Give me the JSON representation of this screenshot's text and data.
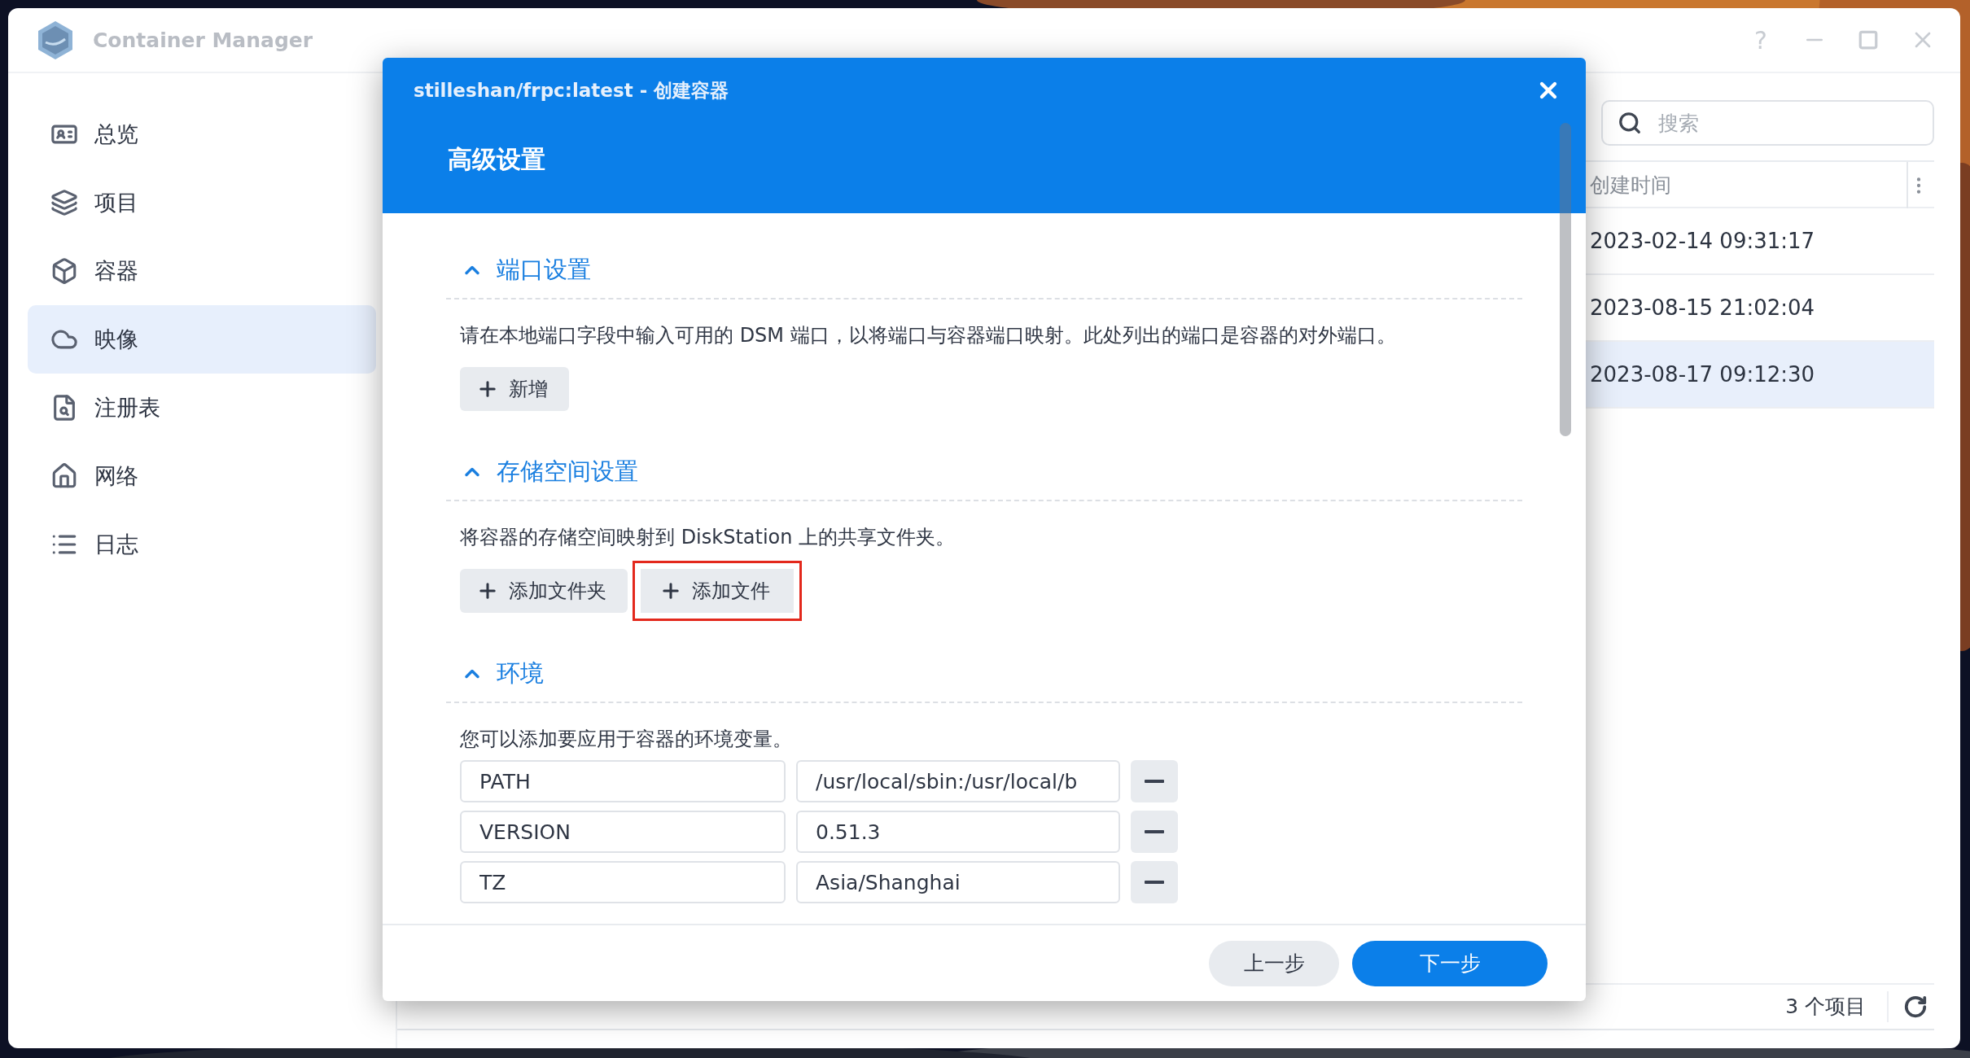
{
  "window": {
    "title": "Container Manager",
    "help": "?"
  },
  "sidebar": {
    "items": [
      {
        "label": "总览",
        "selected": false
      },
      {
        "label": "项目",
        "selected": false
      },
      {
        "label": "容器",
        "selected": false
      },
      {
        "label": "映像",
        "selected": true
      },
      {
        "label": "注册表",
        "selected": false
      },
      {
        "label": "网络",
        "selected": false
      },
      {
        "label": "日志",
        "selected": false
      }
    ]
  },
  "search": {
    "placeholder": "搜索"
  },
  "table": {
    "columns": [
      "创建时间"
    ],
    "rows": [
      {
        "cells": [
          "2023-02-14 09:31:17"
        ],
        "selected": false
      },
      {
        "cells": [
          "2023-08-15 21:02:04"
        ],
        "selected": false
      },
      {
        "cells": [
          "2023-08-17 09:12:30"
        ],
        "selected": true
      }
    ]
  },
  "status_bar": {
    "count": "3 个项目"
  },
  "dialog": {
    "title": "stilleshan/frpc:latest - 创建容器",
    "heading": "高级设置",
    "sections": [
      {
        "title": "端口设置",
        "expanded": true,
        "description": "请在本地端口字段中输入可用的 DSM 端口，以将端口与容器端口映射。此处列出的端口是容器的对外端口。",
        "buttons": [
          {
            "label": "新增",
            "highlighted": false
          }
        ]
      },
      {
        "title": "存储空间设置",
        "expanded": true,
        "description": "将容器的存储空间映射到 DiskStation 上的共享文件夹。",
        "buttons": [
          {
            "label": "添加文件夹",
            "highlighted": false
          },
          {
            "label": "添加文件",
            "highlighted": true
          }
        ]
      },
      {
        "title": "环境",
        "expanded": true,
        "description": "您可以添加要应用于容器的环境变量。",
        "variables": [
          {
            "name": "PATH",
            "value": "/usr/local/sbin:/usr/local/b"
          },
          {
            "name": "VERSION",
            "value": "0.51.3"
          },
          {
            "name": "TZ",
            "value": "Asia/Shanghai"
          }
        ]
      }
    ],
    "footer_buttons": [
      {
        "label": "上一步",
        "kind": "secondary"
      },
      {
        "label": "下一步",
        "kind": "primary"
      }
    ]
  }
}
